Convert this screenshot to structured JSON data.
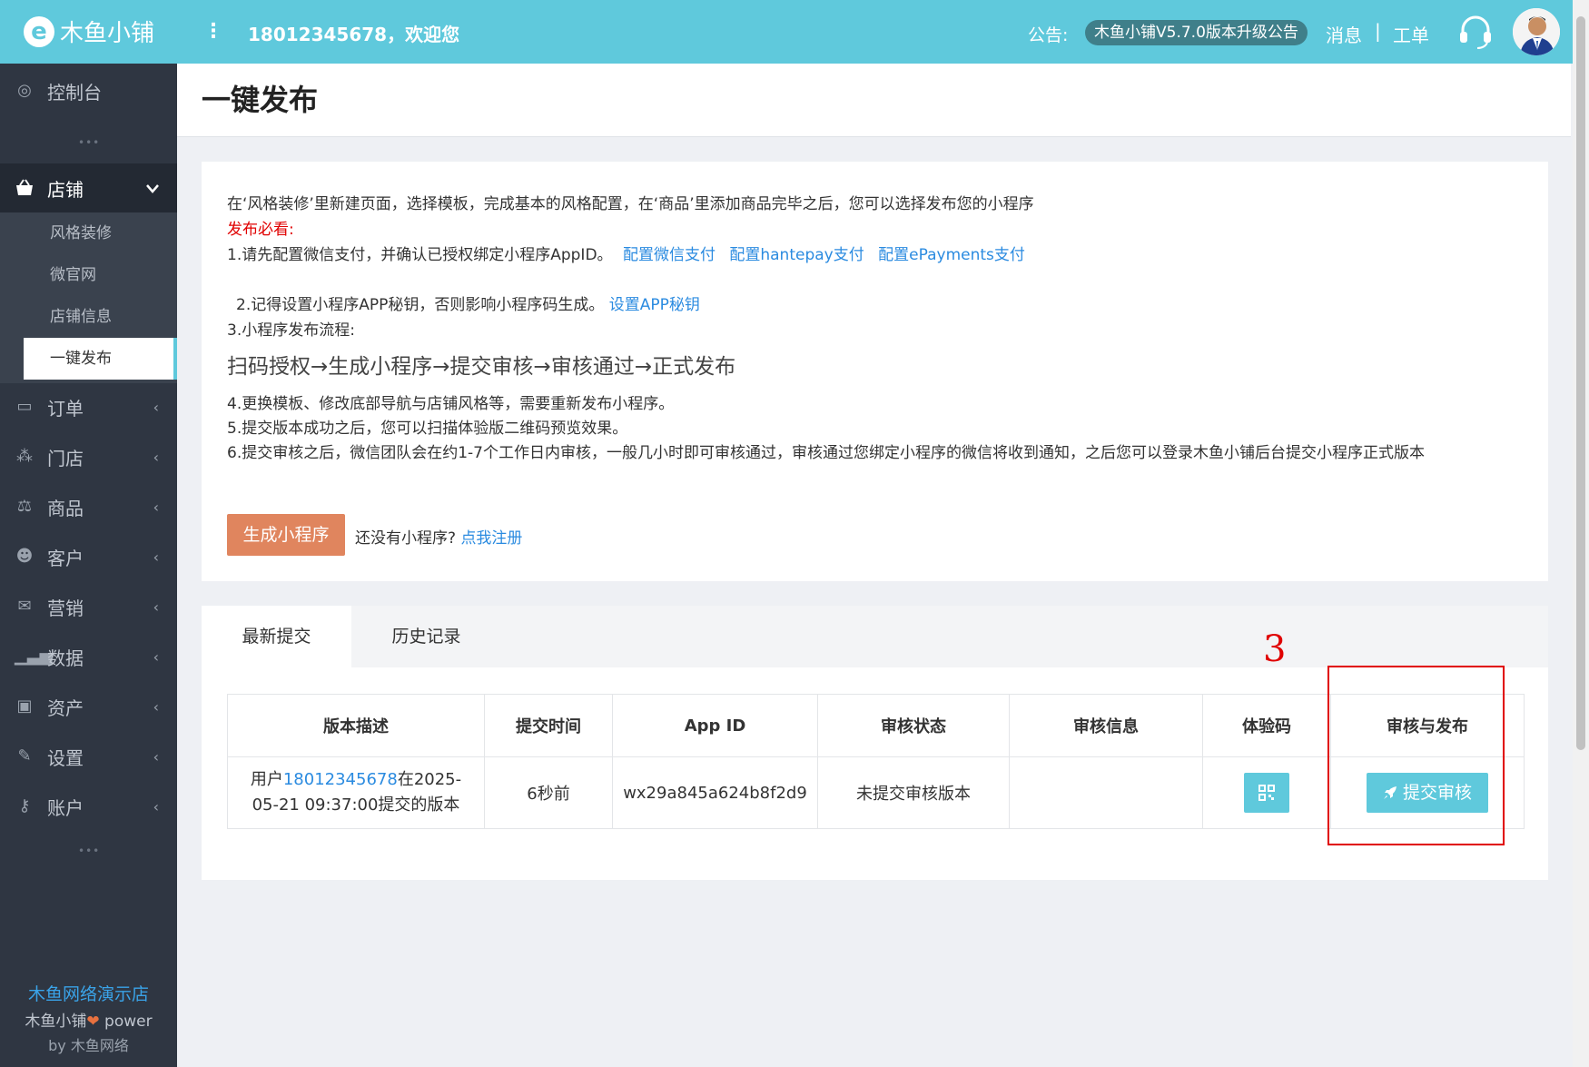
{
  "topbar": {
    "logo_mark": "e",
    "logo_text": "木鱼小铺",
    "menu_icon": "⋮",
    "welcome": "18012345678，欢迎您",
    "notice_label": "公告:",
    "notice_text": "木鱼小铺V5.7.0版本升级公告",
    "messages": "消息",
    "separator": "|",
    "tickets": "工单",
    "icons": [
      "headset-icon",
      "avatar"
    ]
  },
  "sidebar": {
    "dashboard": "控制台",
    "store": "店铺",
    "store_sub": [
      "风格装修",
      "微官网",
      "店铺信息",
      "一键发布"
    ],
    "items": [
      "订单",
      "门店",
      "商品",
      "客户",
      "营销",
      "数据",
      "资产",
      "设置",
      "账户"
    ],
    "icons": [
      "dashboard-icon",
      "basket-icon",
      "order-icon",
      "org-icon",
      "scale-icon",
      "users-icon",
      "gift-icon",
      "chart-icon",
      "money-icon",
      "wrench-icon",
      "key-icon"
    ],
    "dots": "•••",
    "footer_store": "木鱼网络演示店",
    "footer_brand": "木鱼小铺",
    "footer_heart": "❤",
    "footer_power": " power",
    "footer_by": "by 木鱼网络"
  },
  "page": {
    "title": "一键发布"
  },
  "info": {
    "intro": "在‘风格装修’里新建页面，选择模板，完成基本的风格配置，在‘商品’里添加商品完毕之后，您可以选择发布您的小程序",
    "must_read": "发布必看:",
    "step1": "1.请先配置微信支付，并确认已授权绑定小程序AppID。",
    "link_wechat": "配置微信支付",
    "link_hantepay": "配置hantepay支付",
    "link_epayments": "配置ePayments支付",
    "step2": "2.记得设置小程序APP秘钥，否则影响小程序码生成。",
    "link_appsecret": "设置APP秘钥",
    "step3": "3.小程序发布流程:",
    "flow": "扫码授权→生成小程序→提交审核→审核通过→正式发布",
    "step4": "4.更换模板、修改底部导航与店铺风格等，需要重新发布小程序。",
    "step5": "5.提交版本成功之后，您可以扫描体验版二维码预览效果。",
    "step6": "6.提交审核之后，微信团队会在约1-7个工作日内审核，一般几小时即可审核通过，审核通过您绑定小程序的微信将收到通知，之后您可以登录木鱼小铺后台提交小程序正式版本",
    "generate_button": "生成小程序",
    "no_miniprogram": "还没有小程序?",
    "register_link": "点我注册"
  },
  "tabs": [
    "最新提交",
    "历史记录"
  ],
  "annotation": "3",
  "table": {
    "headers": [
      "版本描述",
      "提交时间",
      "App ID",
      "审核状态",
      "审核信息",
      "体验码",
      "审核与发布"
    ],
    "row": {
      "desc_prefix": "用户",
      "desc_user": "18012345678",
      "desc_suffix_line1": "在2025-",
      "desc_line2": "05-21 09:37:00提交的版本",
      "time": "6秒前",
      "appid": "wx29a845a624b8f2d9",
      "status": "未提交审核版本",
      "info": "",
      "qr_icon": "qrcode-icon",
      "submit_icon": "rocket-icon",
      "submit_label": "提交审核"
    }
  }
}
